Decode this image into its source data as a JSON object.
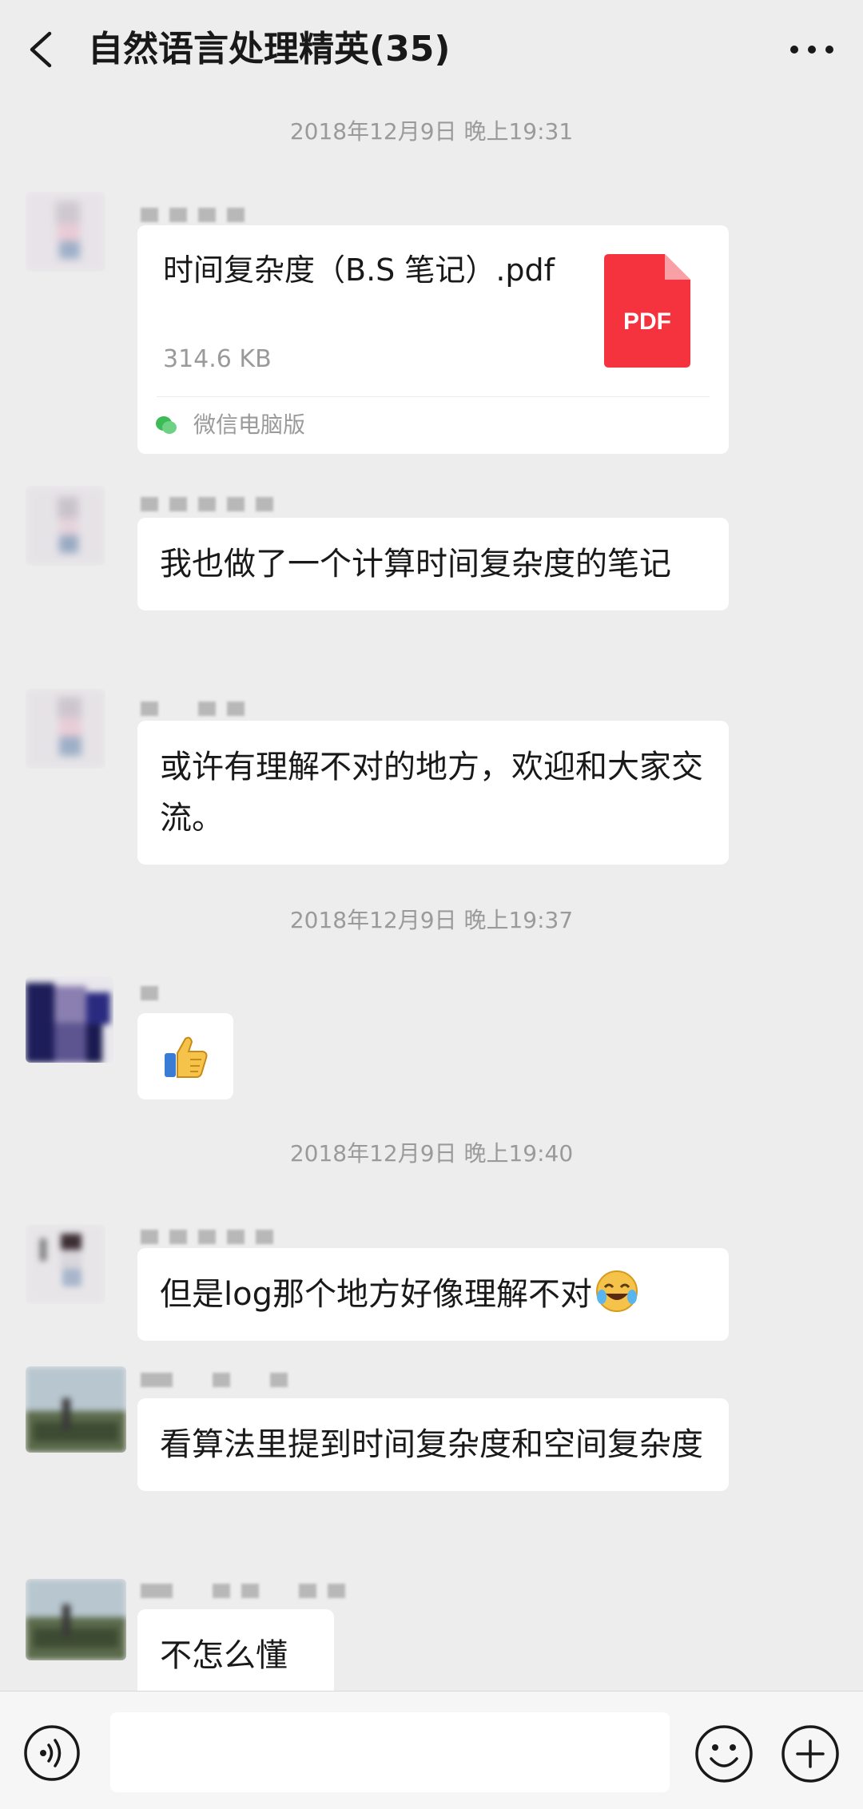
{
  "header": {
    "title": "自然语言处理精英(35)"
  },
  "timestamps": [
    "2018年12月9日 晚上19:31",
    "2018年12月9日 晚上19:37",
    "2018年12月9日 晚上19:40"
  ],
  "messages": {
    "file": {
      "name": "时间复杂度（B.S 笔记）.pdf",
      "size": "314.6 KB",
      "source": "微信电脑版",
      "badge": "PDF",
      "badge_color": "#f5333f"
    },
    "m2": "我也做了一个计算时间复杂度的笔记",
    "m3": "或许有理解不对的地方，欢迎和大家交流。",
    "m4_emoji": "thumbs-up-emoji",
    "m5": "但是log那个地方好像理解不对",
    "m5_emoji": "laughing-crying-emoji",
    "m6": "看算法里提到时间复杂度和空间复杂度",
    "m7": "不怎么懂"
  },
  "icons": {
    "back": "chevron-left-icon",
    "more": "more-dots-icon",
    "voice": "voice-input-icon",
    "emoji": "emoji-icon",
    "plus": "plus-icon",
    "wechat": "wechat-icon"
  },
  "colors": {
    "background": "#ededed",
    "bubble": "#ffffff",
    "pdf_red": "#f5333f",
    "meta_gray": "#9a9a9a"
  }
}
